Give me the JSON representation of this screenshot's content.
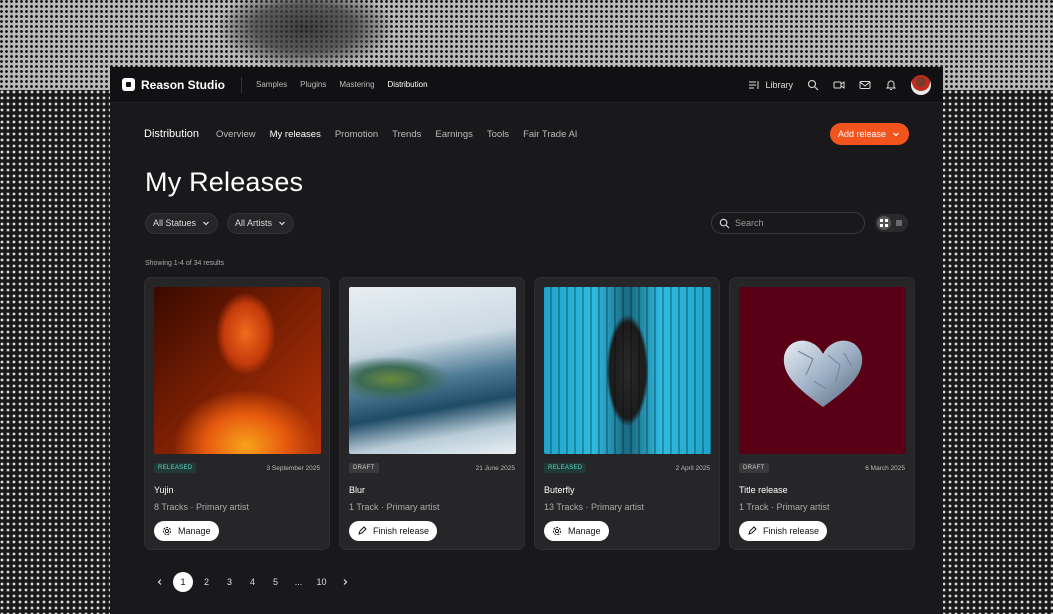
{
  "brand": {
    "name": "Reason Studio"
  },
  "topnav": {
    "links": [
      "Samples",
      "Plugins",
      "Mastering",
      "Distribution"
    ],
    "active": "Distribution",
    "library_label": "Library"
  },
  "subnav": {
    "title": "Distribution",
    "links": [
      "Overview",
      "My releases",
      "Promotion",
      "Trends",
      "Earnings",
      "Tools",
      "Fair Trade AI"
    ],
    "active": "My releases",
    "add_label": "Add release"
  },
  "page": {
    "heading": "My Releases",
    "filter_status": "All Statues",
    "filter_artists": "All Artists",
    "search_placeholder": "Search",
    "results_text": "Showing 1-4 of 34 results"
  },
  "releases": [
    {
      "status": "RELEASED",
      "date": "3 September 2025",
      "title": "Yujin",
      "tracks": "8 Tracks",
      "artist": "Primary artist",
      "action": "Manage"
    },
    {
      "status": "DRAFT",
      "date": "21 June 2025",
      "title": "Blur",
      "tracks": "1 Track",
      "artist": "Primary artist",
      "action": "Finish release"
    },
    {
      "status": "RELEASED",
      "date": "2 April 2025",
      "title": "Buterfly",
      "tracks": "13 Tracks",
      "artist": "Primary artist",
      "action": "Manage"
    },
    {
      "status": "DRAFT",
      "date": "6 March 2025",
      "title": "Title release",
      "tracks": "1 Track",
      "artist": "Primary artist",
      "action": "Finish release"
    }
  ],
  "pagination": {
    "pages": [
      "1",
      "2",
      "3",
      "4",
      "5",
      "...",
      "10"
    ],
    "current": "1"
  },
  "colors": {
    "accent": "#f1541e",
    "released": "#5fd3c4"
  }
}
